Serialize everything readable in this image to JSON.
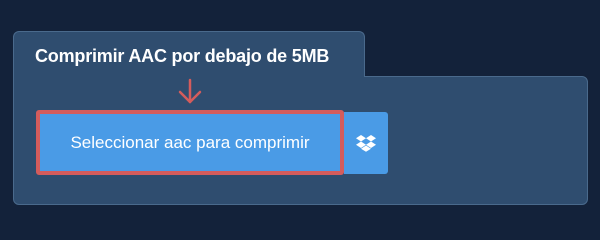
{
  "panel": {
    "title": "Comprimir AAC por debajo de 5MB"
  },
  "upload": {
    "select_label": "Seleccionar aac para comprimir",
    "dropbox_icon": "dropbox-icon"
  },
  "colors": {
    "background": "#13223a",
    "panel": "#2f4d6f",
    "button": "#4a9be6",
    "highlight": "#d45c5c"
  }
}
